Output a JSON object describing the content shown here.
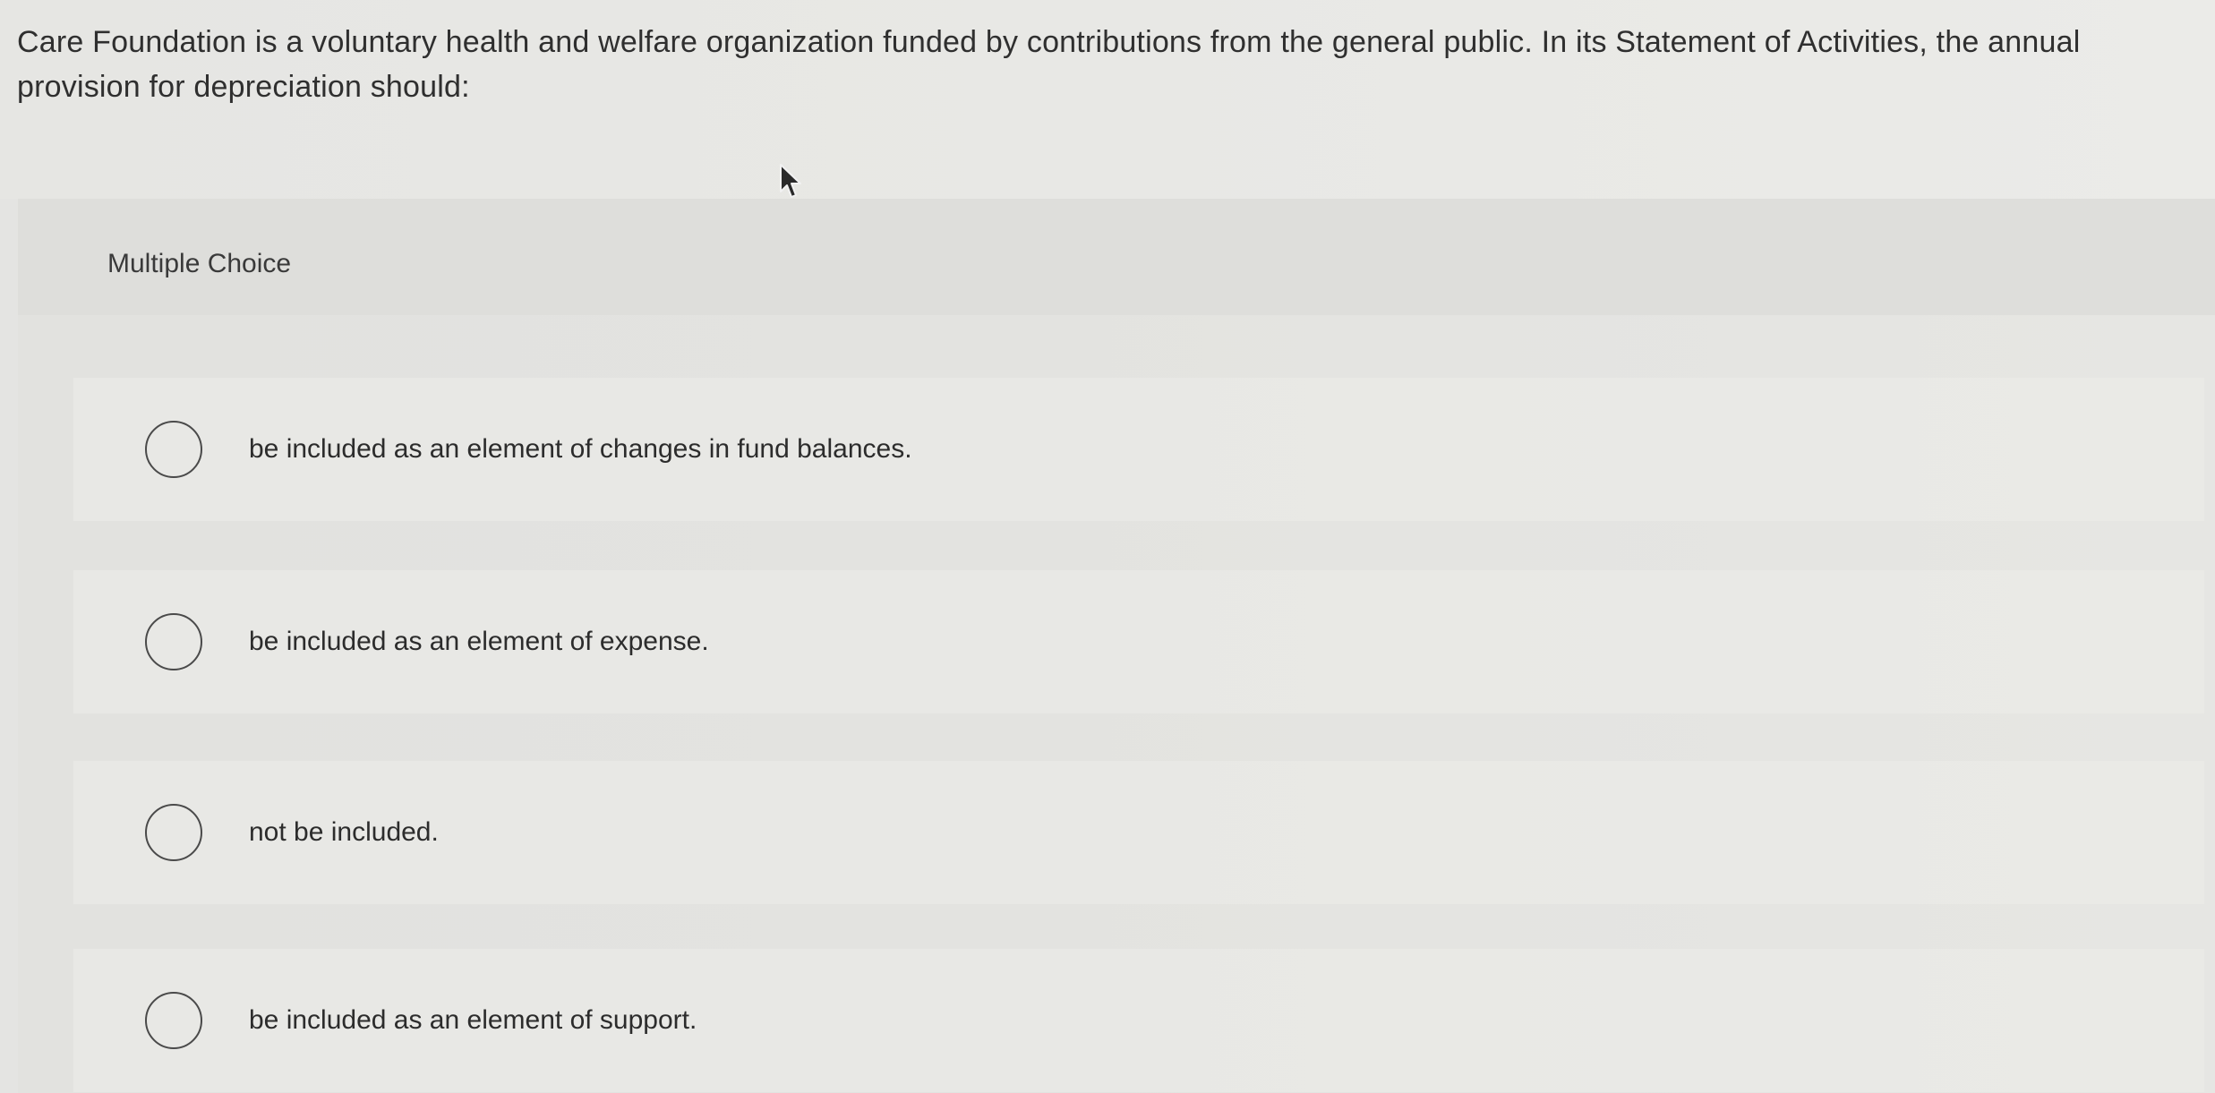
{
  "question": {
    "text": "Care Foundation is a voluntary health and welfare organization funded by contributions from the general public. In its Statement of Activities, the annual provision for depreciation should:"
  },
  "choices": {
    "heading": "Multiple Choice",
    "options": [
      {
        "label": "be included as an element of changes in fund balances.",
        "selected": false
      },
      {
        "label": "be included as an element of expense.",
        "selected": false
      },
      {
        "label": "not be included.",
        "selected": false
      },
      {
        "label": "be included as an element of support.",
        "selected": false
      }
    ]
  },
  "icons": {
    "cursor": "mouse-pointer-icon",
    "radio": "radio-button-empty-icon"
  }
}
